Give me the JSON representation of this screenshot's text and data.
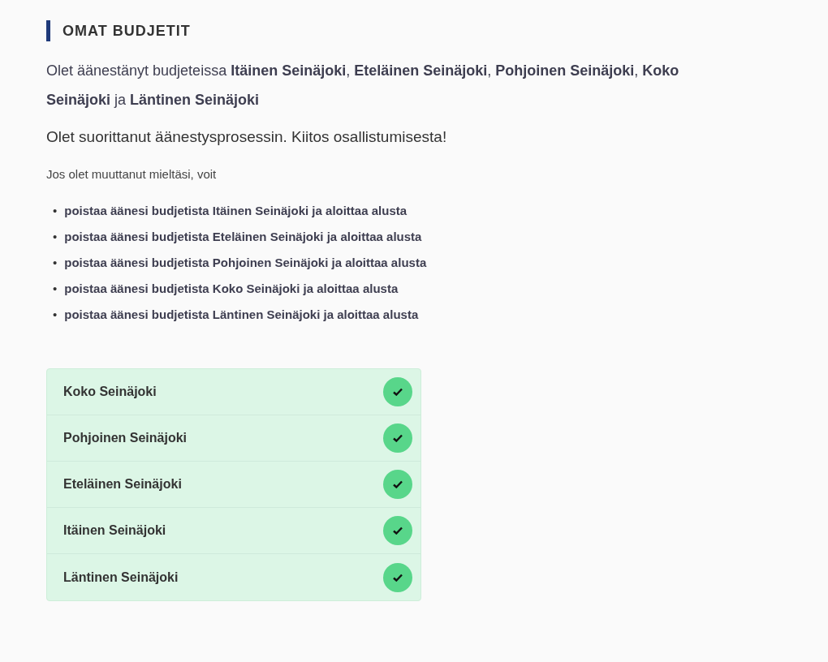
{
  "heading": "OMAT BUDJETIT",
  "voted_text": "Olet äänestänyt budjeteissa **Itäinen Seinäjoki**, **Eteläinen Seinäjoki**, **Pohjoinen Seinäjoki**, **Koko Seinäjoki** ja **Läntinen Seinäjoki**",
  "completed_text": "Olet suorittanut äänestysprosessin. Kiitos osallistumisesta!",
  "change_text": "Jos olet muuttanut mieltäsi, voit",
  "remove_links": [
    {
      "bullet": "•",
      "label": "poistaa äänesi budjetista Itäinen Seinäjoki ja aloittaa alusta"
    },
    {
      "bullet": "•",
      "label": "poistaa äänesi budjetista Eteläinen Seinäjoki ja aloittaa alusta"
    },
    {
      "bullet": "•",
      "label": "poistaa äänesi budjetista Pohjoinen Seinäjoki ja aloittaa alusta"
    },
    {
      "bullet": "•",
      "label": "poistaa äänesi budjetista Koko Seinäjoki ja aloittaa alusta"
    },
    {
      "bullet": "•",
      "label": "poistaa äänesi budjetista Läntinen Seinäjoki ja aloittaa alusta"
    }
  ],
  "budgets": [
    {
      "name": "Koko Seinäjoki",
      "voted": true
    },
    {
      "name": "Pohjoinen Seinäjoki",
      "voted": true
    },
    {
      "name": "Eteläinen Seinäjoki",
      "voted": true
    },
    {
      "name": "Itäinen Seinäjoki",
      "voted": true
    },
    {
      "name": "Läntinen Seinäjoki",
      "voted": true
    }
  ]
}
